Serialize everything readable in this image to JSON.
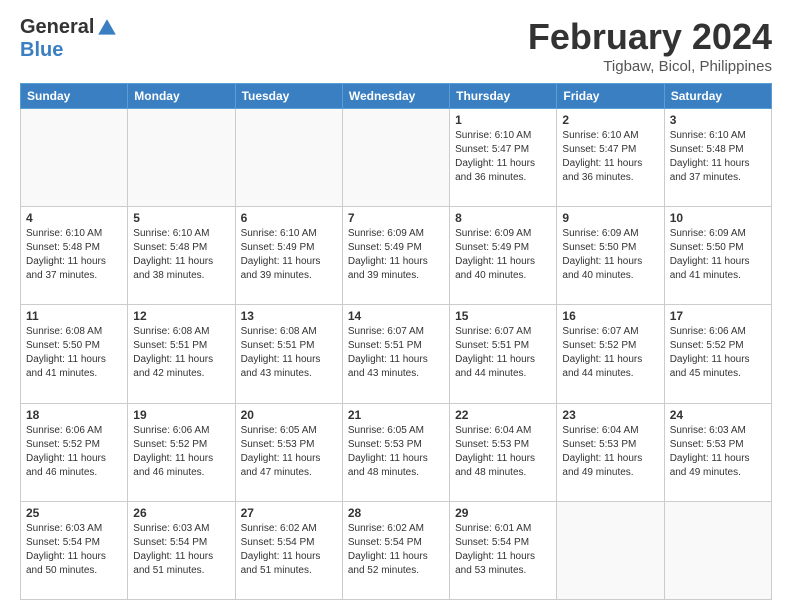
{
  "logo": {
    "line1": "General",
    "line2": "Blue"
  },
  "header": {
    "month_title": "February 2024",
    "location": "Tigbaw, Bicol, Philippines"
  },
  "weekdays": [
    "Sunday",
    "Monday",
    "Tuesday",
    "Wednesday",
    "Thursday",
    "Friday",
    "Saturday"
  ],
  "weeks": [
    [
      {
        "day": "",
        "info": ""
      },
      {
        "day": "",
        "info": ""
      },
      {
        "day": "",
        "info": ""
      },
      {
        "day": "",
        "info": ""
      },
      {
        "day": "1",
        "info": "Sunrise: 6:10 AM\nSunset: 5:47 PM\nDaylight: 11 hours\nand 36 minutes."
      },
      {
        "day": "2",
        "info": "Sunrise: 6:10 AM\nSunset: 5:47 PM\nDaylight: 11 hours\nand 36 minutes."
      },
      {
        "day": "3",
        "info": "Sunrise: 6:10 AM\nSunset: 5:48 PM\nDaylight: 11 hours\nand 37 minutes."
      }
    ],
    [
      {
        "day": "4",
        "info": "Sunrise: 6:10 AM\nSunset: 5:48 PM\nDaylight: 11 hours\nand 37 minutes."
      },
      {
        "day": "5",
        "info": "Sunrise: 6:10 AM\nSunset: 5:48 PM\nDaylight: 11 hours\nand 38 minutes."
      },
      {
        "day": "6",
        "info": "Sunrise: 6:10 AM\nSunset: 5:49 PM\nDaylight: 11 hours\nand 39 minutes."
      },
      {
        "day": "7",
        "info": "Sunrise: 6:09 AM\nSunset: 5:49 PM\nDaylight: 11 hours\nand 39 minutes."
      },
      {
        "day": "8",
        "info": "Sunrise: 6:09 AM\nSunset: 5:49 PM\nDaylight: 11 hours\nand 40 minutes."
      },
      {
        "day": "9",
        "info": "Sunrise: 6:09 AM\nSunset: 5:50 PM\nDaylight: 11 hours\nand 40 minutes."
      },
      {
        "day": "10",
        "info": "Sunrise: 6:09 AM\nSunset: 5:50 PM\nDaylight: 11 hours\nand 41 minutes."
      }
    ],
    [
      {
        "day": "11",
        "info": "Sunrise: 6:08 AM\nSunset: 5:50 PM\nDaylight: 11 hours\nand 41 minutes."
      },
      {
        "day": "12",
        "info": "Sunrise: 6:08 AM\nSunset: 5:51 PM\nDaylight: 11 hours\nand 42 minutes."
      },
      {
        "day": "13",
        "info": "Sunrise: 6:08 AM\nSunset: 5:51 PM\nDaylight: 11 hours\nand 43 minutes."
      },
      {
        "day": "14",
        "info": "Sunrise: 6:07 AM\nSunset: 5:51 PM\nDaylight: 11 hours\nand 43 minutes."
      },
      {
        "day": "15",
        "info": "Sunrise: 6:07 AM\nSunset: 5:51 PM\nDaylight: 11 hours\nand 44 minutes."
      },
      {
        "day": "16",
        "info": "Sunrise: 6:07 AM\nSunset: 5:52 PM\nDaylight: 11 hours\nand 44 minutes."
      },
      {
        "day": "17",
        "info": "Sunrise: 6:06 AM\nSunset: 5:52 PM\nDaylight: 11 hours\nand 45 minutes."
      }
    ],
    [
      {
        "day": "18",
        "info": "Sunrise: 6:06 AM\nSunset: 5:52 PM\nDaylight: 11 hours\nand 46 minutes."
      },
      {
        "day": "19",
        "info": "Sunrise: 6:06 AM\nSunset: 5:52 PM\nDaylight: 11 hours\nand 46 minutes."
      },
      {
        "day": "20",
        "info": "Sunrise: 6:05 AM\nSunset: 5:53 PM\nDaylight: 11 hours\nand 47 minutes."
      },
      {
        "day": "21",
        "info": "Sunrise: 6:05 AM\nSunset: 5:53 PM\nDaylight: 11 hours\nand 48 minutes."
      },
      {
        "day": "22",
        "info": "Sunrise: 6:04 AM\nSunset: 5:53 PM\nDaylight: 11 hours\nand 48 minutes."
      },
      {
        "day": "23",
        "info": "Sunrise: 6:04 AM\nSunset: 5:53 PM\nDaylight: 11 hours\nand 49 minutes."
      },
      {
        "day": "24",
        "info": "Sunrise: 6:03 AM\nSunset: 5:53 PM\nDaylight: 11 hours\nand 49 minutes."
      }
    ],
    [
      {
        "day": "25",
        "info": "Sunrise: 6:03 AM\nSunset: 5:54 PM\nDaylight: 11 hours\nand 50 minutes."
      },
      {
        "day": "26",
        "info": "Sunrise: 6:03 AM\nSunset: 5:54 PM\nDaylight: 11 hours\nand 51 minutes."
      },
      {
        "day": "27",
        "info": "Sunrise: 6:02 AM\nSunset: 5:54 PM\nDaylight: 11 hours\nand 51 minutes."
      },
      {
        "day": "28",
        "info": "Sunrise: 6:02 AM\nSunset: 5:54 PM\nDaylight: 11 hours\nand 52 minutes."
      },
      {
        "day": "29",
        "info": "Sunrise: 6:01 AM\nSunset: 5:54 PM\nDaylight: 11 hours\nand 53 minutes."
      },
      {
        "day": "",
        "info": ""
      },
      {
        "day": "",
        "info": ""
      }
    ]
  ]
}
